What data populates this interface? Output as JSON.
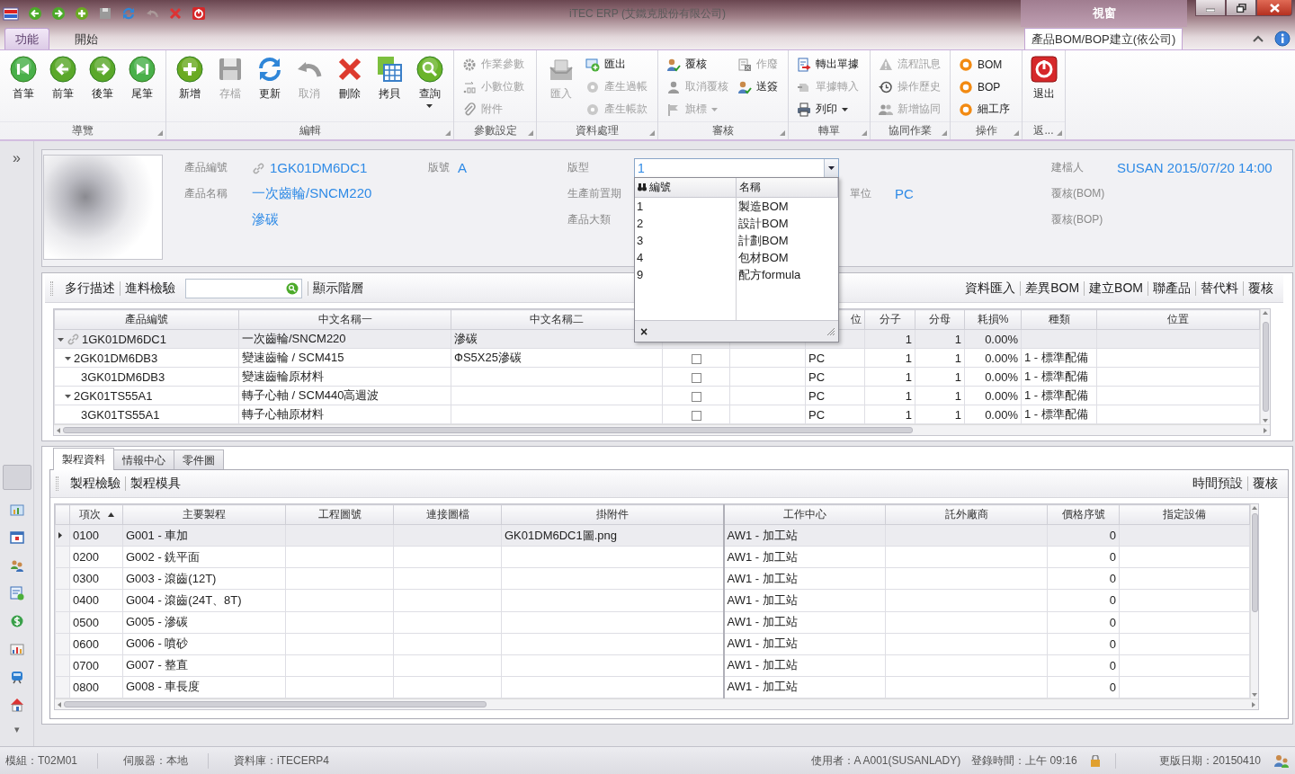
{
  "window": {
    "title": "iTEC ERP (艾鐵克股份有限公司)",
    "window_tab": "視窗"
  },
  "ribbon_tabs": [
    {
      "label": "功能",
      "selected": true
    },
    {
      "label": "開始",
      "selected": false
    }
  ],
  "document_tab": "產品BOM/BOP建立(依公司)",
  "ribbon": {
    "groups": [
      {
        "title": "導覽",
        "items": [
          {
            "kind": "large",
            "label": "首筆",
            "disabled": false
          },
          {
            "kind": "large",
            "label": "前筆",
            "disabled": false
          },
          {
            "kind": "large",
            "label": "後筆",
            "disabled": false
          },
          {
            "kind": "large",
            "label": "尾筆",
            "disabled": false
          }
        ]
      },
      {
        "title": "編輯",
        "items": [
          {
            "kind": "large",
            "label": "新增",
            "disabled": false
          },
          {
            "kind": "large",
            "label": "存檔",
            "disabled": true
          },
          {
            "kind": "large",
            "label": "更新",
            "disabled": false
          },
          {
            "kind": "large",
            "label": "取消",
            "disabled": true
          },
          {
            "kind": "large",
            "label": "刪除",
            "disabled": false
          },
          {
            "kind": "large",
            "label": "拷貝",
            "disabled": false
          },
          {
            "kind": "large",
            "label": "查詢",
            "disabled": false,
            "caret": true
          }
        ]
      },
      {
        "title": "參數設定",
        "items": [
          {
            "kind": "small",
            "label": "作業參數",
            "disabled": true
          },
          {
            "kind": "small",
            "label": "小數位數",
            "disabled": true
          },
          {
            "kind": "small",
            "label": "附件",
            "disabled": true
          }
        ]
      },
      {
        "title": "資料處理",
        "items": [
          {
            "kind": "large",
            "label": "匯入",
            "disabled": true
          },
          {
            "kind": "small",
            "label": "匯出",
            "disabled": false
          },
          {
            "kind": "small",
            "label": "產生過帳",
            "disabled": true
          },
          {
            "kind": "small",
            "label": "產生帳款",
            "disabled": true
          }
        ]
      },
      {
        "title": "審核",
        "items": [
          {
            "kind": "small",
            "label": "覆核",
            "disabled": false
          },
          {
            "kind": "small",
            "label": "取消覆核",
            "disabled": true
          },
          {
            "kind": "small",
            "label": "旗標",
            "disabled": true,
            "caret": true
          },
          {
            "kind": "small",
            "label": "作廢",
            "disabled": true
          },
          {
            "kind": "small",
            "label": "送簽",
            "disabled": false
          }
        ]
      },
      {
        "title": "轉單",
        "items": [
          {
            "kind": "small",
            "label": "轉出單據",
            "disabled": false
          },
          {
            "kind": "small",
            "label": "單據轉入",
            "disabled": true
          },
          {
            "kind": "small",
            "label": "列印",
            "disabled": false,
            "caret": true
          }
        ]
      },
      {
        "title": "協同作業",
        "items": [
          {
            "kind": "small",
            "label": "流程訊息",
            "disabled": true
          },
          {
            "kind": "small",
            "label": "操作歷史",
            "disabled": true
          },
          {
            "kind": "small",
            "label": "新增協同",
            "disabled": true
          }
        ]
      },
      {
        "title": "操作",
        "items": [
          {
            "kind": "small",
            "label": "BOM",
            "disabled": false
          },
          {
            "kind": "small",
            "label": "BOP",
            "disabled": false
          },
          {
            "kind": "small",
            "label": "細工序",
            "disabled": false
          }
        ]
      },
      {
        "title": "返...",
        "items": [
          {
            "kind": "large",
            "label": "退出",
            "disabled": false
          }
        ]
      }
    ]
  },
  "sidebar": {
    "expand_label": "»",
    "scroll_label": "▾"
  },
  "product": {
    "code_label": "產品編號",
    "code": "1GK01DM6DC1",
    "version_label": "版號",
    "version": "A",
    "type_label": "版型",
    "type_value": "1",
    "creator_label": "建檔人",
    "creator": "SUSAN 2015/07/20 14:00",
    "name_label": "產品名稱",
    "name": "一次齒輪/SNCM220",
    "lead_time_label": "生產前置期",
    "unit_label": "單位",
    "unit": "PC",
    "bom_review_label": "覆核(BOM)",
    "spec": "滲碳",
    "category_label": "產品大類",
    "bop_review_label": "覆核(BOP)"
  },
  "type_dropdown": {
    "columns": [
      "編號",
      "名稱"
    ],
    "close_label": "×",
    "options": [
      {
        "code": "1",
        "name": "製造BOM",
        "selected": false
      },
      {
        "code": "2",
        "name": "設計BOM",
        "selected": false
      },
      {
        "code": "3",
        "name": "計劃BOM",
        "selected": false
      },
      {
        "code": "4",
        "name": "包材BOM",
        "selected": false
      },
      {
        "code": "9",
        "name": "配方formula",
        "selected": false
      }
    ]
  },
  "bom_toolbar": {
    "left": [
      "多行描述",
      "進料檢驗"
    ],
    "after_search": [
      "顯示階層"
    ],
    "right": [
      "資料匯入",
      "差異BOM",
      "建立BOM",
      "聯產品",
      "替代料",
      "覆核"
    ]
  },
  "bom_grid": {
    "columns": [
      "產品編號",
      "中文名稱一",
      "中文名稱二",
      "位",
      "分子",
      "分母",
      "耗損%",
      "種類",
      "位置"
    ],
    "rows": [
      {
        "code": "1GK01DM6DC1",
        "name1": "一次齒輪/SNCM220",
        "name2": "滲碳",
        "numerator": "1",
        "denominator": "1",
        "loss": "0.00%",
        "linked": true,
        "selected": true,
        "expanded": true,
        "children": [
          {
            "code": "2GK01DM6DB3",
            "name1": "變速齒輪 / SCM415",
            "name2": "ФS5X25滲碳",
            "checked": false,
            "unit": "PC",
            "numerator": "1",
            "denominator": "1",
            "loss": "0.00%",
            "type": "1 - 標準配備",
            "linked": false,
            "selected": false,
            "expanded": true,
            "children": [
              {
                "code": "3GK01DM6DB3",
                "name1": "變速齒輪原材料",
                "checked": false,
                "unit": "PC",
                "numerator": "1",
                "denominator": "1",
                "loss": "0.00%",
                "type": "1 - 標準配備",
                "linked": false,
                "selected": false
              }
            ]
          },
          {
            "code": "2GK01TS55A1",
            "name1": "轉子心軸 / SCM440高週波",
            "checked": false,
            "unit": "PC",
            "numerator": "1",
            "denominator": "1",
            "loss": "0.00%",
            "type": "1 - 標準配備",
            "linked": false,
            "selected": false,
            "expanded": true,
            "children": [
              {
                "code": "3GK01TS55A1",
                "name1": "轉子心軸原材料",
                "checked": false,
                "unit": "PC",
                "numerator": "1",
                "denominator": "1",
                "loss": "0.00%",
                "type": "1 - 標準配備",
                "linked": false,
                "selected": false
              }
            ]
          }
        ]
      }
    ]
  },
  "process_tabs": [
    {
      "label": "製程資料",
      "selected": true
    },
    {
      "label": "情報中心",
      "selected": false
    },
    {
      "label": "零件圖",
      "selected": false
    }
  ],
  "process_toolbar": {
    "left": [
      "製程檢驗",
      "製程模具"
    ],
    "right": [
      "時間預設",
      "覆核"
    ]
  },
  "process_grid": {
    "columns": [
      "項次",
      "主要製程",
      "工程圖號",
      "連接圖檔",
      "掛附件",
      "工作中心",
      "託外廠商",
      "價格序號",
      "指定設備"
    ],
    "rows": [
      {
        "seq": "0100",
        "process": "G001 - 車加",
        "attachment": "GK01DM6DC1圖.png",
        "work_center": "AW1 - 加工站",
        "price_seq": "0",
        "selected": true
      },
      {
        "seq": "0200",
        "process": "G002 - 銑平面",
        "work_center": "AW1 - 加工站",
        "price_seq": "0",
        "selected": false
      },
      {
        "seq": "0300",
        "process": "G003 - 滾齒(12T)",
        "work_center": "AW1 - 加工站",
        "price_seq": "0",
        "selected": false
      },
      {
        "seq": "0400",
        "process": "G004 - 滾齒(24T、8T)",
        "work_center": "AW1 - 加工站",
        "price_seq": "0",
        "selected": false
      },
      {
        "seq": "0500",
        "process": "G005 - 滲碳",
        "work_center": "AW1 - 加工站",
        "price_seq": "0",
        "selected": false
      },
      {
        "seq": "0600",
        "process": "G006 - 噴砂",
        "work_center": "AW1 - 加工站",
        "price_seq": "0",
        "selected": false
      },
      {
        "seq": "0700",
        "process": "G007 - 整直",
        "work_center": "AW1 - 加工站",
        "price_seq": "0",
        "selected": false
      },
      {
        "seq": "0800",
        "process": "G008 - 車長度",
        "work_center": "AW1 - 加工站",
        "price_seq": "0",
        "selected": false
      }
    ]
  },
  "status_bar": {
    "module": "模組：T02M01",
    "server": "伺服器：本地",
    "database": "資料庫：iTECERP4",
    "user": "使用者：A A001(SUSANLADY)",
    "login": "登錄時間：上午 09:16",
    "version_date": "更版日期：20150410"
  }
}
